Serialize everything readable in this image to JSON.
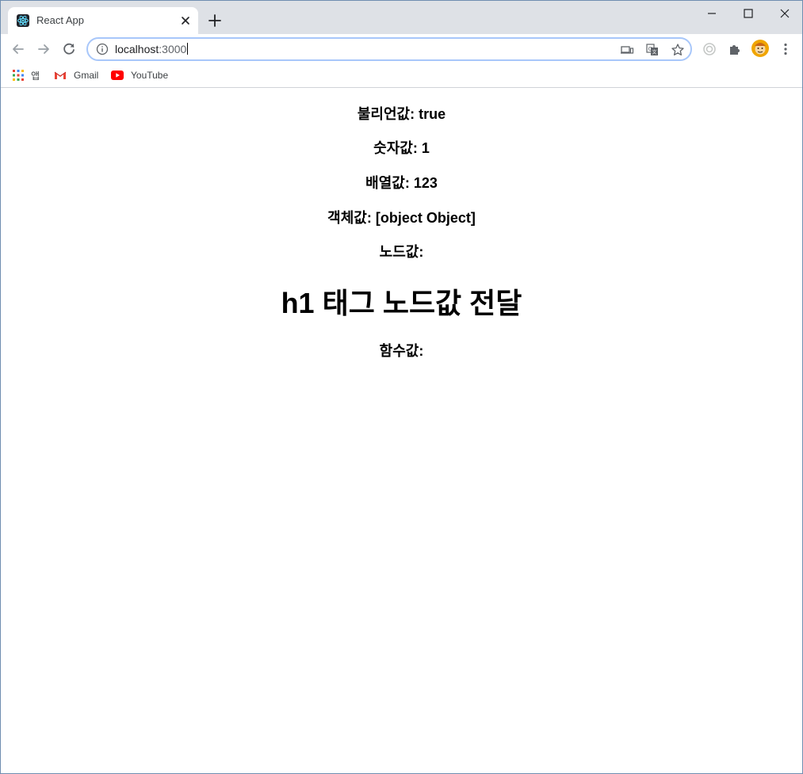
{
  "browser": {
    "tab_title": "React App",
    "url_host": "localhost",
    "url_port": ":3000",
    "bookmarks": [
      {
        "label": "앱",
        "icon": "apps-grid-icon"
      },
      {
        "label": "Gmail",
        "icon": "gmail-icon"
      },
      {
        "label": "YouTube",
        "icon": "youtube-icon"
      }
    ]
  },
  "page": {
    "lines": [
      "불리언값: true",
      "숫자값: 1",
      "배열값: 123",
      "객체값: [object Object]",
      "노드값:"
    ],
    "heading": "h1 태그 노드값 전달",
    "function_line": "함수값:"
  },
  "colors": {
    "tab_strip": "#dee1e6",
    "omnibox_border": "#a8c7fa",
    "react_logo": "#61dafb"
  }
}
